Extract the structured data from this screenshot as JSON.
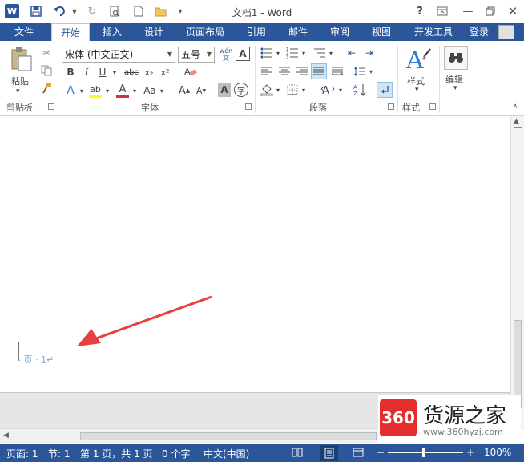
{
  "titlebar": {
    "title": "文档1 - Word",
    "logo_letter": "W",
    "help": "?"
  },
  "tabs": {
    "file": "文件",
    "home": "开始",
    "insert": "插入",
    "design": "设计",
    "layout": "页面布局",
    "references": "引用",
    "mailings": "邮件",
    "review": "审阅",
    "view": "视图",
    "developer": "开发工具",
    "login": "登录"
  },
  "ribbon": {
    "clipboard": {
      "paste": "粘贴",
      "label": "剪贴板"
    },
    "font": {
      "font_name": "宋体 (中文正文)",
      "font_size": "五号",
      "wen": "wén\n文",
      "label": "字体",
      "bold": "B",
      "italic": "I",
      "underline": "U",
      "strike": "abc",
      "sub": "x₂",
      "sup": "x²",
      "aa": "Aa",
      "grow": "A",
      "shrink": "A",
      "char_shade": "A"
    },
    "paragraph": {
      "label": "段落"
    },
    "styles": {
      "button": "样式",
      "label": "样式"
    },
    "editing": {
      "button": "编辑"
    }
  },
  "document": {
    "page_number_text": "- 页 · 1↵"
  },
  "statusbar": {
    "page": "页面: 1",
    "section": "节: 1",
    "page_of": "第 1 页，共 1 页",
    "words": "0 个字",
    "language": "中文(中国)",
    "zoom": "100%"
  },
  "watermark": {
    "logo": "360",
    "text": "货源之家",
    "url": "www.360hyzj.com"
  },
  "colors": {
    "word_blue": "#2b579a",
    "highlight_yellow": "#ffff00",
    "font_red": "#d13438",
    "arrow_red": "#e84040"
  }
}
